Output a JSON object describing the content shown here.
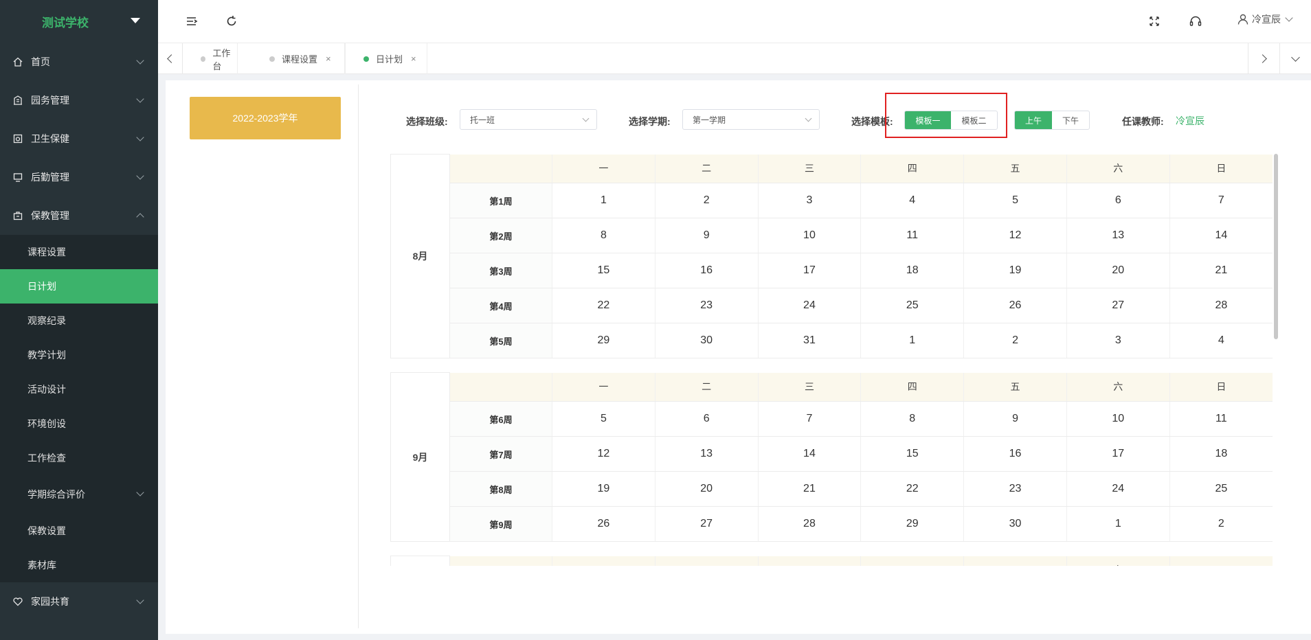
{
  "sidebar": {
    "school": "测试学校",
    "menu": [
      {
        "label": "首页",
        "icon": "home-icon"
      },
      {
        "label": "园务管理",
        "icon": "building-icon"
      },
      {
        "label": "卫生保健",
        "icon": "health-icon"
      },
      {
        "label": "后勤管理",
        "icon": "monitor-icon"
      },
      {
        "label": "保教管理",
        "icon": "briefcase-icon"
      }
    ],
    "submenu": [
      "课程设置",
      "日计划",
      "观察纪录",
      "教学计划",
      "活动设计",
      "环境创设",
      "工作检查",
      "学期综合评价",
      "保教设置",
      "素材库"
    ],
    "active_sub": "日计划",
    "last_menu": {
      "label": "家园共育",
      "icon": "heart-icon"
    }
  },
  "topbar": {
    "user_name": "冷宣辰",
    "icons": [
      "menu-fold-icon",
      "refresh-icon",
      "fullscreen-icon",
      "headset-icon",
      "user-icon"
    ]
  },
  "tabs": [
    {
      "label": "工作台",
      "closable": false,
      "active": false
    },
    {
      "label": "课程设置",
      "closable": true,
      "active": false
    },
    {
      "label": "日计划",
      "closable": true,
      "active": true
    }
  ],
  "tab_close_glyph": "×",
  "year_button": "2022-2023学年",
  "filters": {
    "class_label": "选择班级:",
    "class_value": "托一班",
    "term_label": "选择学期:",
    "term_value": "第一学期",
    "template_label": "选择模板:",
    "template_options": [
      "模板一",
      "模板二"
    ],
    "template_selected": "模板一",
    "period_options": [
      "上午",
      "下午"
    ],
    "period_selected": "上午",
    "teacher_label": "任课教师:",
    "teacher_value": "冷宣辰"
  },
  "highlight_color": "#e02020",
  "accent_color": "#3cb36b",
  "calendar": {
    "weekdays": [
      "一",
      "二",
      "三",
      "四",
      "五",
      "六",
      "日"
    ],
    "months": [
      {
        "month": "8月",
        "weeks": [
          {
            "week": "第1周",
            "days": [
              1,
              2,
              3,
              4,
              5,
              6,
              7
            ]
          },
          {
            "week": "第2周",
            "days": [
              8,
              9,
              10,
              11,
              12,
              13,
              14
            ]
          },
          {
            "week": "第3周",
            "days": [
              15,
              16,
              17,
              18,
              19,
              20,
              21
            ]
          },
          {
            "week": "第4周",
            "days": [
              22,
              23,
              24,
              25,
              26,
              27,
              28
            ]
          },
          {
            "week": "第5周",
            "days": [
              29,
              30,
              31,
              1,
              2,
              3,
              4
            ]
          }
        ]
      },
      {
        "month": "9月",
        "weeks": [
          {
            "week": "第6周",
            "days": [
              5,
              6,
              7,
              8,
              9,
              10,
              11
            ]
          },
          {
            "week": "第7周",
            "days": [
              12,
              13,
              14,
              15,
              16,
              17,
              18
            ]
          },
          {
            "week": "第8周",
            "days": [
              19,
              20,
              21,
              22,
              23,
              24,
              25
            ]
          },
          {
            "week": "第9周",
            "days": [
              26,
              27,
              28,
              29,
              30,
              1,
              2
            ]
          }
        ]
      },
      {
        "month": "",
        "weeks": []
      }
    ]
  }
}
